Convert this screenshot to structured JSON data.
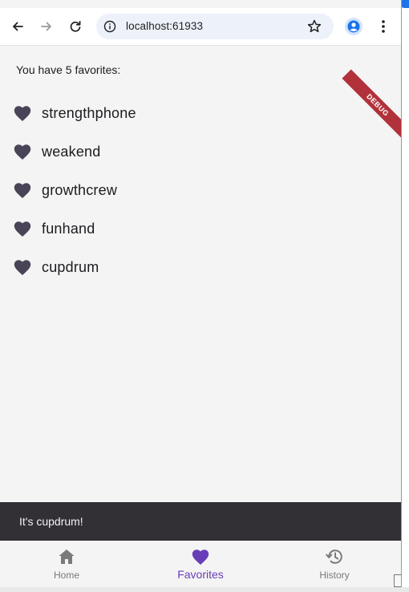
{
  "browser": {
    "url": "localhost:61933",
    "icons": {
      "back": "arrow-left-icon",
      "forward": "arrow-right-icon",
      "reload": "reload-icon",
      "site_info": "info-icon",
      "bookmark": "star-icon",
      "profile": "person-icon",
      "menu": "kebab-menu-icon"
    }
  },
  "debug_banner": "DEBUG",
  "favorites": {
    "count_text": "You have 5 favorites:",
    "items": [
      {
        "word": "strengthphone",
        "icon": "heart-icon"
      },
      {
        "word": "weakend",
        "icon": "heart-icon"
      },
      {
        "word": "growthcrew",
        "icon": "heart-icon"
      },
      {
        "word": "funhand",
        "icon": "heart-icon"
      },
      {
        "word": "cupdrum",
        "icon": "heart-icon"
      }
    ]
  },
  "snackbar": {
    "message": "It's cupdrum!"
  },
  "bottom_nav": {
    "items": [
      {
        "label": "Home",
        "icon": "home-icon",
        "active": false
      },
      {
        "label": "Favorites",
        "icon": "heart-icon",
        "active": true
      },
      {
        "label": "History",
        "icon": "history-icon",
        "active": false
      }
    ]
  },
  "colors": {
    "accent": "#6a3db8",
    "heart": "#4a4458",
    "snackbar_bg": "#322f35",
    "debug_banner": "#b1323a"
  }
}
